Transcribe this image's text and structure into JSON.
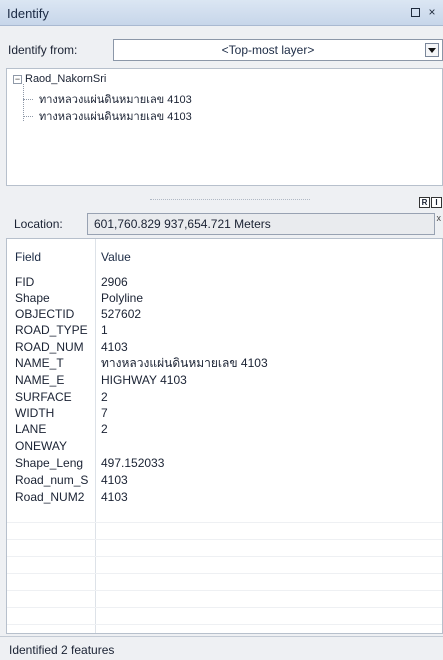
{
  "window": {
    "title": "Identify",
    "buttons": [
      {
        "name": "restore-button",
        "glyph": "restore"
      },
      {
        "name": "close-button",
        "glyph": "×"
      }
    ]
  },
  "identify_from": {
    "label": "Identify from:",
    "selected": "<Top-most layer>"
  },
  "tree": {
    "root_label": "Raod_NakornSri",
    "expander": "−",
    "children": [
      "ทางหลวงแผ่นดินหมายเลข 4103",
      "ทางหลวงแผ่นดินหมายเลข 4103"
    ]
  },
  "view_buttons": {
    "left": "R",
    "right": "I"
  },
  "location": {
    "label": "Location:",
    "value": "601,760.829  937,654.721 Meters",
    "pin_icon": "pin-icon"
  },
  "attributes": {
    "header": {
      "field": "Field",
      "value": "Value"
    },
    "rows": [
      {
        "field": "FID",
        "value": "2906"
      },
      {
        "field": "Shape",
        "value": "Polyline"
      },
      {
        "field": "OBJECTID",
        "value": "527602"
      },
      {
        "field": "ROAD_TYPE",
        "value": "1"
      },
      {
        "field": "ROAD_NUM",
        "value": "4103"
      },
      {
        "field": "NAME_T",
        "value": "ทางหลวงแผ่นดินหมายเลข 4103"
      },
      {
        "field": "NAME_E",
        "value": "HIGHWAY 4103"
      },
      {
        "field": "SURFACE",
        "value": "2"
      },
      {
        "field": "WIDTH",
        "value": "7"
      },
      {
        "field": "LANE",
        "value": "2"
      },
      {
        "field": "ONEWAY",
        "value": ""
      },
      {
        "field": "Shape_Leng",
        "value": "497.152033"
      },
      {
        "field": "Road_num_S",
        "value": "4103"
      },
      {
        "field": "Road_NUM2",
        "value": "4103"
      }
    ]
  },
  "status": {
    "text": "Identified 2 features"
  }
}
